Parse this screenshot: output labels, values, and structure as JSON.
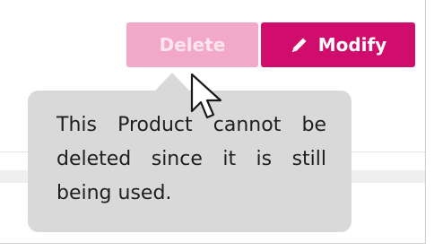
{
  "actions": {
    "delete_label": "Delete",
    "modify_label": "Modify"
  },
  "tooltip": {
    "message": "This Product cannot be deleted since it is still being used."
  },
  "icons": {
    "modify": "pencil-icon",
    "cursor": "mouse-pointer-icon"
  },
  "colors": {
    "delete_disabled": "#f2a8c8",
    "modify_primary": "#d00d6c",
    "tooltip_background": "#d9d9d9"
  }
}
